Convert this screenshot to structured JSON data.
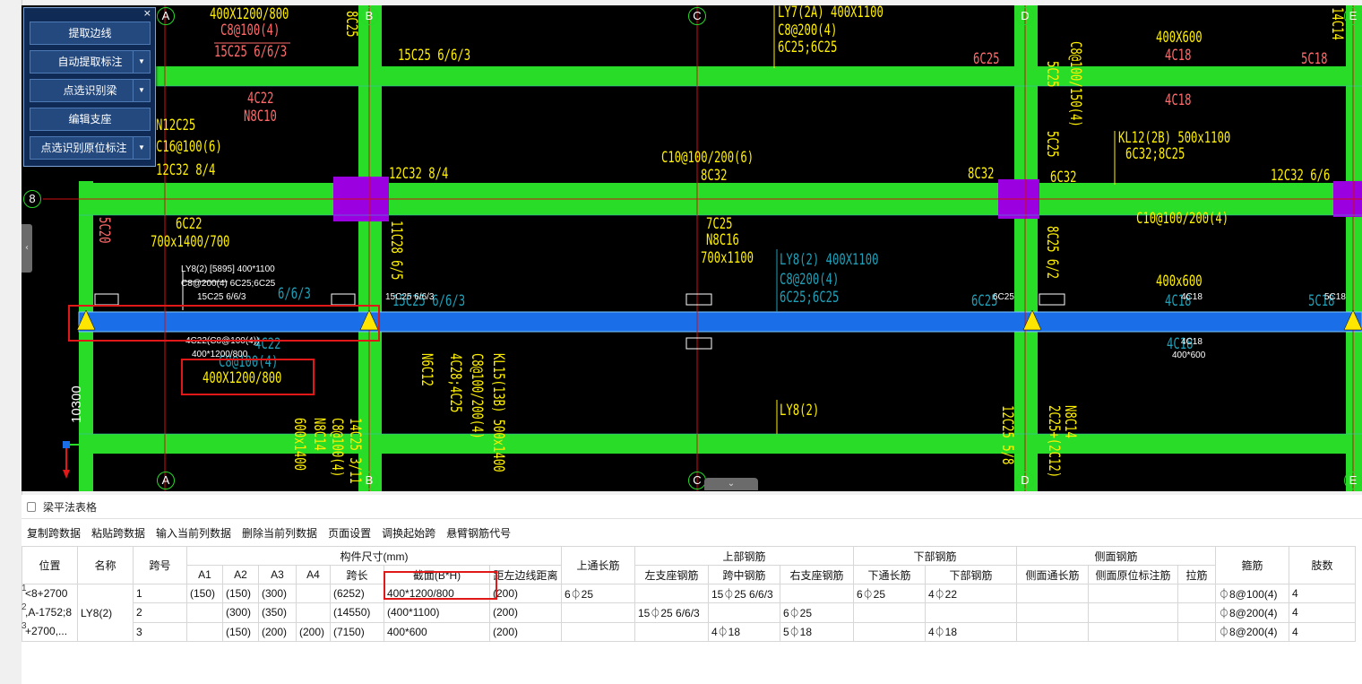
{
  "toolbox": {
    "close": "×",
    "buttons": [
      "提取边线",
      "自动提取标注",
      "点选识别梁",
      "编辑支座",
      "点选识别原位标注"
    ],
    "dropdown_flags": [
      false,
      true,
      true,
      false,
      true
    ]
  },
  "axes": {
    "top": [
      "A",
      "B",
      "C",
      "D",
      "E"
    ],
    "bottom": [
      "A",
      "B",
      "C",
      "D",
      "E"
    ],
    "left": "8",
    "dimension": "10300"
  },
  "cad_text": {
    "t1": "400X1200/800",
    "t2": "C8@100(4)",
    "t3": "15C25 6/6/3",
    "t4": "8C25",
    "t5": "15C25 6/6/3",
    "t6": "LY7(2A) 400X1100",
    "t7": "C8@200(4)",
    "t8": "6C25;6C25",
    "t9": "6C25",
    "t10": "400X600",
    "t11": "4C18",
    "t12": "5C18",
    "t13": "14C14",
    "t14": "4C22",
    "t15": "N8C10",
    "t16": "4C18",
    "t17": "N12C25",
    "t18": "C16@100(6)",
    "t19": "12C32 8/4",
    "t20": "12C32 8/4",
    "t21": "C10@100/200(6)",
    "t22": "8C32",
    "t23": "8C32",
    "t24": "KL12(2B) 500x1100",
    "t25": "6C32;8C25",
    "t26": "6C32",
    "t27": "12C32 6/6",
    "t28": "C10@100/200(4)",
    "t29": "5C25",
    "t30": "C8@100/150(4)",
    "t31": "5C25",
    "t32": "6C22",
    "t33": "700x1400/700",
    "t34": "5C20",
    "t35": "11C28 6/5",
    "t36": "7C25",
    "t37": "N8C16",
    "t38": "700x1100",
    "t39": "LY8(2) 400X1100",
    "t40": "C8@200(4)",
    "t41": "6C25;6C25",
    "t42": "8C25 6/2",
    "t43": "6C25",
    "t44": "400x600",
    "t45": "4C18",
    "t46": "5C18",
    "t47": "6/6/3",
    "t48": "15C25 6/6/3",
    "t49": "N6C12",
    "t50": "4C28;4C25",
    "t51": "C8@100/200(4)",
    "t52": "KL15(13B) 500x1400",
    "t53": "400X1200/800",
    "t54": "C8@100(4)",
    "t55": "4C22",
    "t56": "LY8(2)",
    "t57": "12C25 5/8",
    "t58": "N8C14",
    "t59": "2C25+(2C12)",
    "t60": "4C18",
    "t61": "600x1400",
    "t62": "N8C14",
    "t63": "C8@100(4)",
    "t64": "14C25 3/11"
  },
  "cad_labels": {
    "w1": "LY8(2) [5895] 400*1100",
    "w2": "C8@200(4) 6C25;6C25",
    "w3": "15C25 6/6/3",
    "w4": "15C25 6/6/3",
    "w5": "6C25",
    "w6": "4C18",
    "w7": "5C18",
    "w8": "4C22(C8@100(4))",
    "w9": "400*1200/800",
    "w10": "4C18",
    "w11": "400*600"
  },
  "colors": {
    "beam": "#28dc28",
    "selected_beam": "#1a6fe8",
    "column": "#9a00e0",
    "axis_line": "#d01010",
    "highlight_box": "#e01818"
  },
  "panel": {
    "title": "梁平法表格",
    "toolbar": [
      "复制跨数据",
      "粘贴跨数据",
      "输入当前列数据",
      "删除当前列数据",
      "页面设置",
      "调换起始跨",
      "悬臂钢筋代号"
    ],
    "group_headers": {
      "size": "构件尺寸(mm)",
      "top": "上部钢筋",
      "bottom": "下部钢筋",
      "side": "侧面钢筋"
    },
    "headers": {
      "pos": "位置",
      "name": "名称",
      "span": "跨号",
      "a1": "A1",
      "a2": "A2",
      "a3": "A3",
      "a4": "A4",
      "len": "跨长",
      "section": "截面(B*H)",
      "edge": "距左边线距离",
      "top_through": "上通长筋",
      "left_sup": "左支座钢筋",
      "mid": "跨中钢筋",
      "right_sup": "右支座钢筋",
      "bot_through": "下通长筋",
      "bot": "下部钢筋",
      "side_through": "侧面通长筋",
      "side_orig": "侧面原位标注筋",
      "tie": "拉筋",
      "stirrup": "箍筋",
      "legs": "肢数"
    },
    "row_numbers": [
      "1",
      "2",
      "3"
    ],
    "position_lines": [
      "<8+2700",
      ",A-1752;8",
      "+2700,..."
    ],
    "beam_name": "LY8(2)",
    "rows": [
      {
        "span": "1",
        "a1": "(150)",
        "a2": "(150)",
        "a3": "(300)",
        "a4": "",
        "len": "(6252)",
        "section": "400*1200/800",
        "edge": "(200)",
        "top_through": "6⏀25",
        "left_sup": "",
        "mid": "15⏀25 6/6/3",
        "right_sup": "",
        "bot_through": "6⏀25",
        "bot": "4⏀22",
        "side_through": "",
        "side_orig": "",
        "tie": "",
        "stirrup": "⏀8@100(4)",
        "legs": "4"
      },
      {
        "span": "2",
        "a1": "",
        "a2": "(300)",
        "a3": "(350)",
        "a4": "",
        "len": "(14550)",
        "section": "(400*1100)",
        "edge": "(200)",
        "top_through": "",
        "left_sup": "15⏀25 6/6/3",
        "mid": "",
        "right_sup": "6⏀25",
        "bot_through": "",
        "bot": "",
        "side_through": "",
        "side_orig": "",
        "tie": "",
        "stirrup": "⏀8@200(4)",
        "legs": "4"
      },
      {
        "span": "3",
        "a1": "",
        "a2": "(150)",
        "a3": "(200)",
        "a4": "(200)",
        "len": "(7150)",
        "section": "400*600",
        "edge": "(200)",
        "top_through": "",
        "left_sup": "",
        "mid": "4⏀18",
        "right_sup": "5⏀18",
        "bot_through": "",
        "bot": "4⏀18",
        "side_through": "",
        "side_orig": "",
        "tie": "",
        "stirrup": "⏀8@200(4)",
        "legs": "4"
      }
    ]
  }
}
